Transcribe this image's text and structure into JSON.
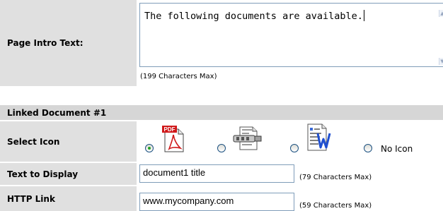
{
  "intro": {
    "label": "Page Intro Text:",
    "value": "The following documents are available.",
    "max_note": "(199 Characters Max)"
  },
  "linked_document": {
    "header": "Linked Document #1",
    "select_icon": {
      "label": "Select Icon",
      "options": [
        {
          "icon": "pdf-icon",
          "badge": "PDF",
          "selected": true
        },
        {
          "icon": "zip-file-icon",
          "selected": false
        },
        {
          "icon": "word-document-icon",
          "selected": false
        },
        {
          "label": "No Icon",
          "selected": false
        }
      ]
    },
    "text_to_display": {
      "label": "Text to Display",
      "value": "document1 title",
      "max_note": "(79 Characters Max)"
    },
    "http_link": {
      "label": "HTTP Link",
      "value": "www.mycompany.com",
      "max_note": "(59 Characters Max)"
    }
  },
  "colors": {
    "label_bg": "#e0e0e0",
    "header_bg": "#d6d6d6",
    "input_border": "#7f9db9",
    "pdf_red": "#d0181a",
    "radio_dot": "#21a121"
  }
}
